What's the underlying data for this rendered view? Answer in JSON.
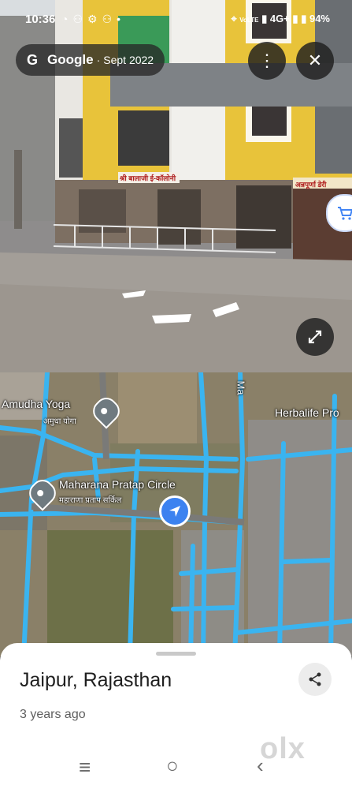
{
  "status_bar": {
    "time": "10:36",
    "left_icons": [
      "whatsapp-icon",
      "notification-icon",
      "settings-icon",
      "notification-icon",
      "dot"
    ],
    "network_label": "VoLTE",
    "network_type": "4G+",
    "battery": "94%"
  },
  "street_view": {
    "brand": "Google",
    "separator": "·",
    "capture_date": "Sept 2022",
    "sign_left": "श्री बालाजी ई-कॉलोनी",
    "sign_right": "अन्नपूर्णा डेरी"
  },
  "map": {
    "labels": {
      "amudha_yoga_en": "Amudha Yoga",
      "amudha_yoga_hi": "अमुधा योगा",
      "maharana_en": "Maharana Pratap Circle",
      "maharana_hi": "महाराणा प्रताप सर्किल",
      "herbalife": "Herbalife Pro",
      "road_top": "Ma"
    }
  },
  "sheet": {
    "place": "Jaipur, Rajasthan",
    "time_ago": "3 years ago",
    "watermark": "olx"
  },
  "colors": {
    "road": "#3ab4f0",
    "accent": "#3c82f0"
  }
}
